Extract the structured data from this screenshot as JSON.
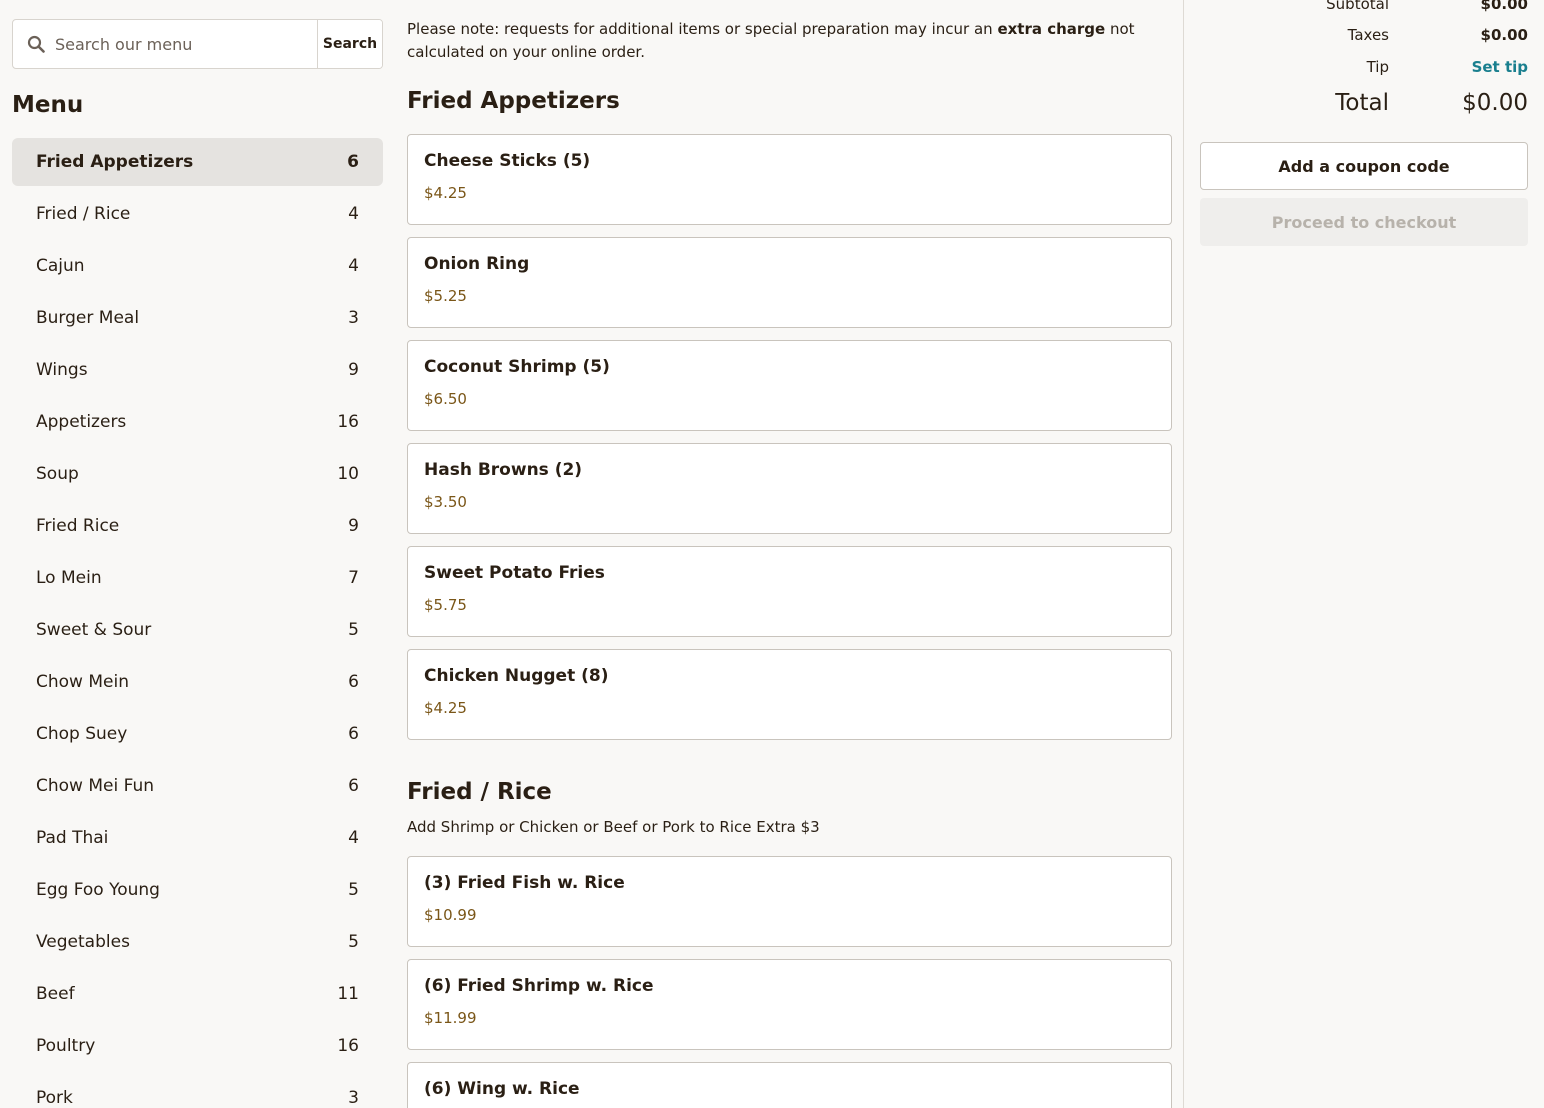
{
  "search": {
    "placeholder": "Search our menu",
    "button_label": "Search"
  },
  "menu": {
    "heading": "Menu",
    "categories": [
      {
        "label": "Fried Appetizers",
        "count": "6",
        "active": true
      },
      {
        "label": "Fried / Rice",
        "count": "4"
      },
      {
        "label": "Cajun",
        "count": "4"
      },
      {
        "label": "Burger Meal",
        "count": "3"
      },
      {
        "label": "Wings",
        "count": "9"
      },
      {
        "label": "Appetizers",
        "count": "16"
      },
      {
        "label": "Soup",
        "count": "10"
      },
      {
        "label": "Fried Rice",
        "count": "9"
      },
      {
        "label": "Lo Mein",
        "count": "7"
      },
      {
        "label": "Sweet & Sour",
        "count": "5"
      },
      {
        "label": "Chow Mein",
        "count": "6"
      },
      {
        "label": "Chop Suey",
        "count": "6"
      },
      {
        "label": "Chow Mei Fun",
        "count": "6"
      },
      {
        "label": "Pad Thai",
        "count": "4"
      },
      {
        "label": "Egg Foo Young",
        "count": "5"
      },
      {
        "label": "Vegetables",
        "count": "5"
      },
      {
        "label": "Beef",
        "count": "11"
      },
      {
        "label": "Poultry",
        "count": "16"
      },
      {
        "label": "Pork",
        "count": "3"
      }
    ]
  },
  "notice": {
    "prefix": "Please note: requests for additional items or special preparation may incur an ",
    "emphasis": "extra charge",
    "suffix": " not calculated on your online order."
  },
  "sections": [
    {
      "title": "Fried Appetizers",
      "description": "",
      "items": [
        {
          "name": "Cheese Sticks (5)",
          "price": "$4.25"
        },
        {
          "name": "Onion Ring",
          "price": "$5.25"
        },
        {
          "name": "Coconut Shrimp (5)",
          "price": "$6.50"
        },
        {
          "name": "Hash Browns (2)",
          "price": "$3.50"
        },
        {
          "name": "Sweet Potato Fries",
          "price": "$5.75"
        },
        {
          "name": "Chicken Nugget (8)",
          "price": "$4.25"
        }
      ]
    },
    {
      "title": "Fried / Rice",
      "description": "Add Shrimp or Chicken or Beef or Pork to Rice Extra $3",
      "items": [
        {
          "name": "(3) Fried Fish w. Rice",
          "price": "$10.99"
        },
        {
          "name": "(6) Fried Shrimp w. Rice",
          "price": "$11.99"
        },
        {
          "name": "(6) Wing w. Rice",
          "price": ""
        }
      ]
    }
  ],
  "summary": {
    "subtotal_label": "Subtotal",
    "subtotal_value": "$0.00",
    "taxes_label": "Taxes",
    "taxes_value": "$0.00",
    "tip_label": "Tip",
    "tip_value": "Set tip",
    "total_label": "Total",
    "total_value": "$0.00",
    "coupon_label": "Add a coupon code",
    "checkout_label": "Proceed to checkout"
  },
  "colors": {
    "price": "#7a5618",
    "link": "#1a7f8e",
    "active_category_bg": "#e5e3e0"
  }
}
